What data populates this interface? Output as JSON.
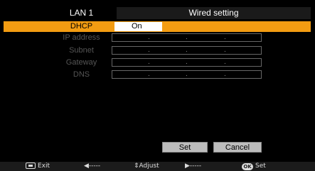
{
  "header": {
    "lan_label": "LAN 1",
    "title": "Wired setting"
  },
  "rows": [
    {
      "label": "DHCP",
      "value": "On"
    },
    {
      "label": "IP address"
    },
    {
      "label": "Subnet"
    },
    {
      "label": "Gateway"
    },
    {
      "label": "DNS"
    }
  ],
  "buttons": {
    "set": "Set",
    "cancel": "Cancel"
  },
  "footer": {
    "exit": "Exit",
    "left": "◀-----",
    "adjust": "Adjust",
    "right": "▶-----",
    "ok_icon": "OK",
    "set": "Set"
  },
  "colors": {
    "selected": "#f39c12",
    "background": "#000000"
  }
}
